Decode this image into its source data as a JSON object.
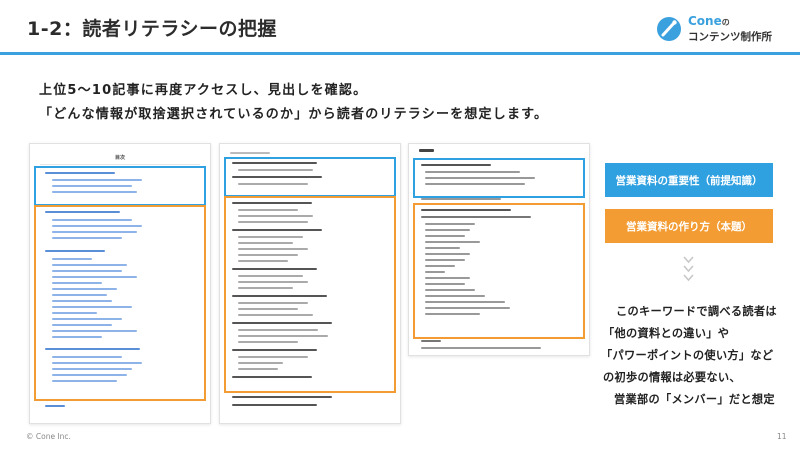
{
  "slide": {
    "title": "1-2：読者リテラシーの把握",
    "logo": {
      "line1": "Cone",
      "line1_suffix": "の",
      "line2": "コンテンツ制作所"
    },
    "lead_lines": [
      "上位5～10記事に再度アクセスし、見出しを確認。",
      "「どんな情報が取捨選択されているのか」から読者のリテラシーを想定します。"
    ],
    "callouts": {
      "primary": "営業資料の重要性（前提知識）",
      "secondary": "営業資料の作り方（本題）"
    },
    "note_lines": [
      "このキーワードで調べる読者は",
      "「他の資料との違い」や",
      "「パワーポイントの使い方」など",
      "の初歩の情報は必要ない、",
      "営業部の「メンバー」だと想定"
    ],
    "footer": "© Cone Inc.",
    "page_number": "11"
  },
  "screenshots": {
    "first_toc_title": "目次",
    "third_toc_title": "目次"
  },
  "colors": {
    "accent_blue": "#2fa0e0",
    "accent_orange": "#f39c33",
    "title_rule": "#3aa0de"
  },
  "icons": [
    "cone-logo-icon",
    "chevron-down-icon"
  ]
}
